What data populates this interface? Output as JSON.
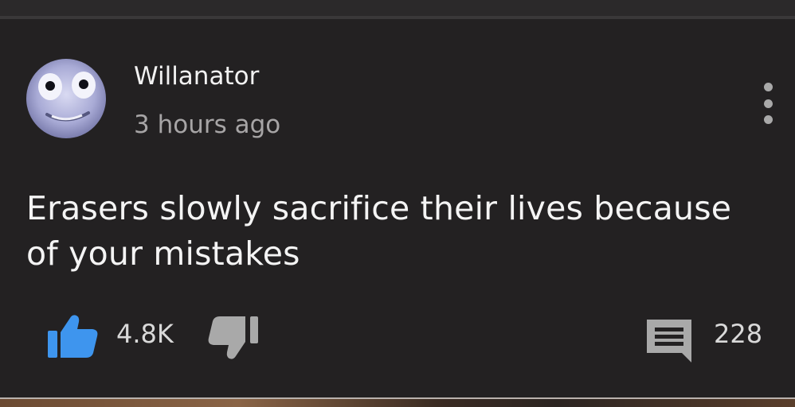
{
  "comment": {
    "author": "Willanator",
    "timestamp": "3 hours ago",
    "text": "Erasers slowly sacrifice their lives because of your mistakes",
    "like_count": "4.8K",
    "reply_count": "228"
  },
  "icons": {
    "avatar": "avatar",
    "menu": "more-vert-icon",
    "like": "thumbs-up-icon",
    "dislike": "thumbs-down-icon",
    "reply": "comment-icon"
  },
  "colors": {
    "background": "#232122",
    "like_active": "#3e95ee",
    "icon_inactive": "#a9a9a9",
    "text_primary": "#f4f4f4",
    "text_secondary": "#a7a5a6"
  }
}
